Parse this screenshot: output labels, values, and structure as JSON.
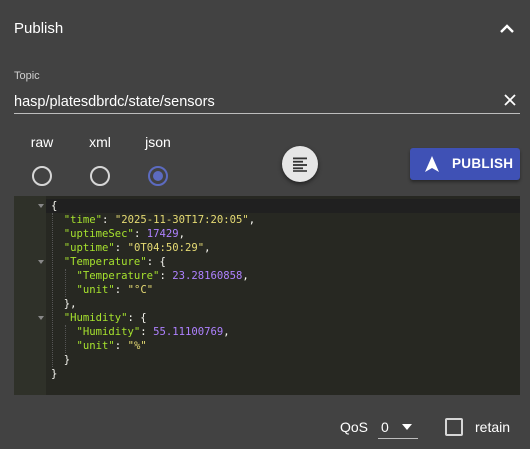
{
  "header": {
    "title": "Publish",
    "collapse_icon": "chevron-up-icon"
  },
  "topic": {
    "label": "Topic",
    "value": "hasp/platesdbrdc/state/sensors",
    "clear_icon": "close-icon"
  },
  "formats": [
    {
      "label": "raw",
      "checked": false
    },
    {
      "label": "xml",
      "checked": false
    },
    {
      "label": "json",
      "checked": true
    }
  ],
  "format_button": {
    "icon": "format-align-left-icon"
  },
  "publish_button": {
    "label": "PUBLISH",
    "icon": "navigation-arrow-icon"
  },
  "editor": {
    "lines": [
      [
        [
          "p",
          "{"
        ]
      ],
      [
        [
          "p",
          "  "
        ],
        [
          "k",
          "\"time\""
        ],
        [
          "p",
          ": "
        ],
        [
          "s",
          "\"2025-11-30T17:20:05\""
        ],
        [
          "p",
          ","
        ]
      ],
      [
        [
          "p",
          "  "
        ],
        [
          "k",
          "\"uptimeSec\""
        ],
        [
          "p",
          ": "
        ],
        [
          "n",
          "17429"
        ],
        [
          "p",
          ","
        ]
      ],
      [
        [
          "p",
          "  "
        ],
        [
          "k",
          "\"uptime\""
        ],
        [
          "p",
          ": "
        ],
        [
          "s",
          "\"0T04:50:29\""
        ],
        [
          "p",
          ","
        ]
      ],
      [
        [
          "p",
          "  "
        ],
        [
          "k",
          "\"Temperature\""
        ],
        [
          "p",
          ": {"
        ]
      ],
      [
        [
          "p",
          "    "
        ],
        [
          "k",
          "\"Temperature\""
        ],
        [
          "p",
          ": "
        ],
        [
          "n",
          "23.28160858"
        ],
        [
          "p",
          ","
        ]
      ],
      [
        [
          "p",
          "    "
        ],
        [
          "k",
          "\"unit\""
        ],
        [
          "p",
          ": "
        ],
        [
          "s",
          "\"°C\""
        ]
      ],
      [
        [
          "p",
          "  },"
        ]
      ],
      [
        [
          "p",
          "  "
        ],
        [
          "k",
          "\"Humidity\""
        ],
        [
          "p",
          ": {"
        ]
      ],
      [
        [
          "p",
          "    "
        ],
        [
          "k",
          "\"Humidity\""
        ],
        [
          "p",
          ": "
        ],
        [
          "n",
          "55.11100769"
        ],
        [
          "p",
          ","
        ]
      ],
      [
        [
          "p",
          "    "
        ],
        [
          "k",
          "\"unit\""
        ],
        [
          "p",
          ": "
        ],
        [
          "s",
          "\"%\""
        ]
      ],
      [
        [
          "p",
          "  }"
        ]
      ],
      [
        [
          "p",
          "}"
        ]
      ]
    ],
    "fold_lines": [
      0,
      4,
      8
    ]
  },
  "qos": {
    "label": "QoS",
    "value": "0"
  },
  "retain": {
    "label": "retain",
    "checked": false
  },
  "colors": {
    "accent": "#3f51b5",
    "background": "#424242",
    "editor_bg": "#272822"
  }
}
